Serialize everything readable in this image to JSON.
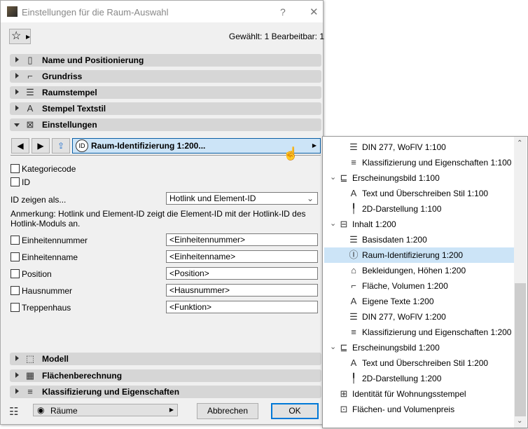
{
  "window": {
    "title": "Einstellungen für die Raum-Auswahl",
    "help": "?",
    "close": "✕"
  },
  "status": "Gewählt: 1 Bearbeitbar: 1",
  "sections_top": [
    {
      "label": "Name und Positionierung",
      "icon": "name-position-icon",
      "glyph": "▯"
    },
    {
      "label": "Grundriss",
      "icon": "floor-plan-icon",
      "glyph": "⌐"
    },
    {
      "label": "Raumstempel",
      "icon": "zone-stamp-icon",
      "glyph": "☰"
    },
    {
      "label": "Stempel Textstil",
      "icon": "text-style-icon",
      "glyph": "A"
    },
    {
      "label": "Einstellungen",
      "icon": "settings-icon",
      "glyph": "⊠",
      "open": true
    }
  ],
  "toolbar": {
    "current_page": "Raum-Identifizierung 1:200..."
  },
  "checks": {
    "kategoriecode": "Kategoriecode",
    "id": "ID"
  },
  "id_show": {
    "label": "ID zeigen als...",
    "value": "Hotlink und Element-ID"
  },
  "note": [
    "Anmerkung: Hotlink und Element-ID zeigt die Element-ID mit der Hotlink-ID des",
    "Hotlink-Moduls an."
  ],
  "fields": [
    {
      "label": "Einheitennummer",
      "value": "<Einheitennummer>"
    },
    {
      "label": "Einheitenname",
      "value": "<Einheitenname>"
    },
    {
      "label": "Position",
      "value": "<Position>"
    },
    {
      "label": "Hausnummer",
      "value": "<Hausnummer>"
    },
    {
      "label": "Treppenhaus",
      "value": "<Funktion>"
    }
  ],
  "sections_bottom": [
    {
      "label": "Modell",
      "icon": "model-icon",
      "glyph": "⬚"
    },
    {
      "label": "Flächenberechnung",
      "icon": "area-calc-icon",
      "glyph": "▦"
    },
    {
      "label": "Klassifizierung und Eigenschaften",
      "icon": "classification-icon",
      "glyph": "≡"
    }
  ],
  "footer": {
    "layer": "Räume",
    "cancel": "Abbrechen",
    "ok": "OK"
  },
  "popup": [
    {
      "label": "DIN 277, WoFlV 1:100",
      "level": 2,
      "icon": "list-icon",
      "glyph": "☰"
    },
    {
      "label": "Klassifizierung und Eigenschaften 1:100",
      "level": 2,
      "icon": "document-icon",
      "glyph": "≡"
    },
    {
      "label": "Erscheinungsbild 1:100",
      "level": 1,
      "icon": "appearance-icon",
      "glyph": "⊑"
    },
    {
      "label": "Text und Überschreiben Stil 1:100",
      "level": 2,
      "icon": "text-style-icon",
      "glyph": "A"
    },
    {
      "label": "2D-Darstellung 1:100",
      "level": 2,
      "icon": "pen-icon",
      "glyph": "╿"
    },
    {
      "label": "Inhalt 1:200",
      "level": 1,
      "icon": "content-icon",
      "glyph": "⊟"
    },
    {
      "label": "Basisdaten 1:200",
      "level": 2,
      "icon": "basic-data-icon",
      "glyph": "☰"
    },
    {
      "label": "Raum-Identifizierung 1:200",
      "level": 2,
      "icon": "id-icon",
      "glyph": "Ⓘ",
      "selected": true
    },
    {
      "label": "Bekleidungen, Höhen 1:200",
      "level": 2,
      "icon": "finishes-icon",
      "glyph": "⌂"
    },
    {
      "label": "Fläche, Volumen 1:200",
      "level": 2,
      "icon": "area-icon",
      "glyph": "⌐"
    },
    {
      "label": "Eigene Texte 1:200",
      "level": 2,
      "icon": "custom-text-icon",
      "glyph": "A"
    },
    {
      "label": "DIN 277, WoFlV 1:200",
      "level": 2,
      "icon": "list-icon",
      "glyph": "☰"
    },
    {
      "label": "Klassifizierung und Eigenschaften 1:200",
      "level": 2,
      "icon": "document-icon",
      "glyph": "≡"
    },
    {
      "label": "Erscheinungsbild 1:200",
      "level": 1,
      "icon": "appearance-icon",
      "glyph": "⊑"
    },
    {
      "label": "Text und Überschreiben Stil 1:200",
      "level": 2,
      "icon": "text-style-icon",
      "glyph": "A"
    },
    {
      "label": "2D-Darstellung 1:200",
      "level": 2,
      "icon": "pen-icon",
      "glyph": "╿"
    },
    {
      "label": "Identität für Wohnungsstempel",
      "level": 0,
      "icon": "apartment-stamp-icon",
      "glyph": "⊞"
    },
    {
      "label": "Flächen- und Volumenpreis",
      "level": 0,
      "icon": "price-icon",
      "glyph": "⊡"
    }
  ],
  "colors": {
    "selected": "#cce4f7",
    "accent": "#0078d7",
    "section": "#d6d6d6"
  }
}
